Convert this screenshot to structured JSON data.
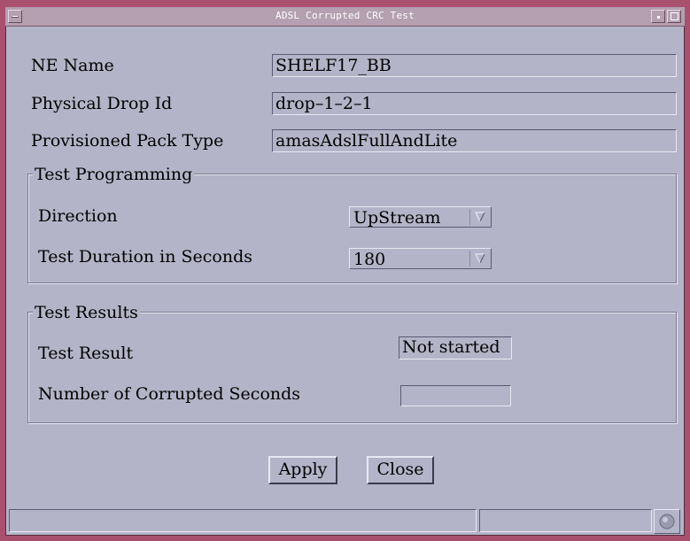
{
  "window": {
    "title": "ADSL Corrupted CRC Test"
  },
  "form": {
    "ne_name": {
      "label": "NE Name",
      "value": "SHELF17_BB"
    },
    "physical_drop_id": {
      "label": "Physical Drop Id",
      "value": "drop–1–2–1"
    },
    "provisioned_pack_type": {
      "label": "Provisioned Pack Type",
      "value": "amasAdslFullAndLite"
    }
  },
  "test_programming": {
    "title": "Test Programming",
    "direction": {
      "label": "Direction",
      "value": "UpStream"
    },
    "duration": {
      "label": "Test Duration in Seconds",
      "value": "180"
    }
  },
  "test_results": {
    "title": "Test Results",
    "result": {
      "label": "Test Result",
      "value": "Not started"
    },
    "corrupted_seconds": {
      "label": "Number of Corrupted Seconds",
      "value": ""
    }
  },
  "buttons": {
    "apply": "Apply",
    "close": "Close"
  },
  "icons": {
    "menu": "window-menu-icon",
    "minimize": "minimize-icon",
    "maximize": "maximize-icon",
    "dropdown": "dropdown-arrow-icon",
    "status": "status-indicator-icon"
  },
  "colors": {
    "background": "#b4b4c8",
    "frame": "#a8506e",
    "titlebar": "#b4a0b0"
  }
}
